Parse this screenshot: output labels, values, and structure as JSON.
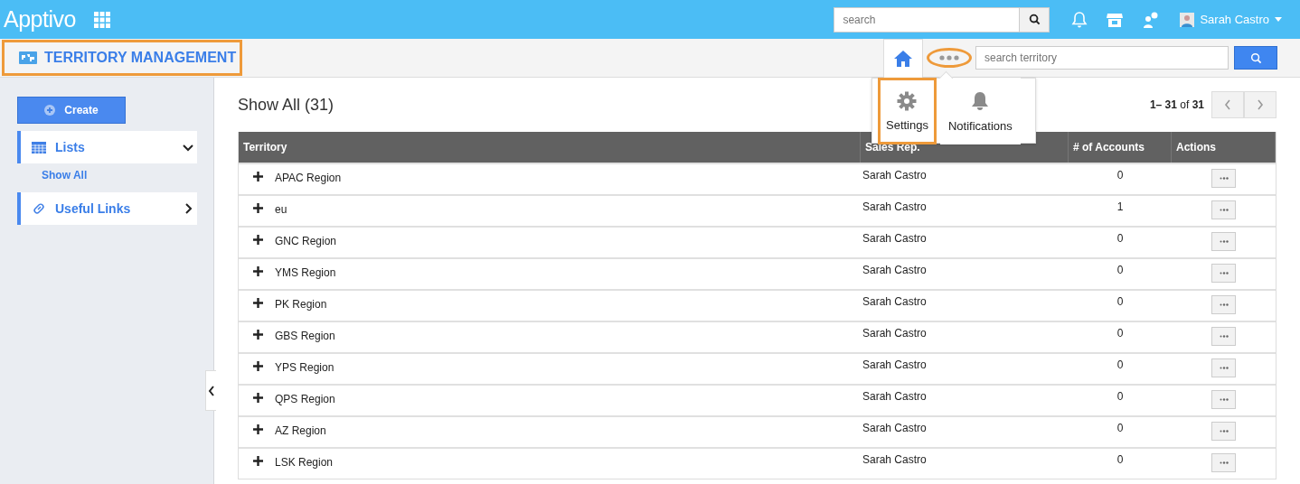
{
  "top_bar": {
    "logo": "Apptivo",
    "search": {
      "placeholder": "search"
    },
    "user": "Sarah Castro"
  },
  "app_bar": {
    "title": "TERRITORY MANAGEMENT",
    "title_highlighted": true,
    "more_highlighted": true,
    "search": {
      "placeholder": "search territory"
    }
  },
  "popup_menu": {
    "items": [
      {
        "label": "Settings",
        "kind": "settings",
        "highlighted": true
      },
      {
        "label": "Notifications",
        "kind": "notifications",
        "highlighted": false
      }
    ]
  },
  "sidebar": {
    "create": "Create",
    "sections": [
      {
        "label": "Lists",
        "kind": "lists",
        "expanded": true,
        "children": [
          {
            "label": "Show All",
            "selected": true
          }
        ]
      },
      {
        "label": "Useful Links",
        "kind": "links",
        "expanded": false
      }
    ]
  },
  "content": {
    "heading": "Show All (31)",
    "pagination": "**1– 31** of **31**"
  },
  "table": {
    "columns": [
      "Territory",
      "Sales Rep.",
      "# of Accounts",
      "Actions"
    ],
    "rows": [
      {
        "territory": "APAC Region",
        "sales_rep": "Sarah Castro",
        "accounts": "0"
      },
      {
        "territory": "eu",
        "sales_rep": "Sarah Castro",
        "accounts": "1"
      },
      {
        "territory": "GNC Region",
        "sales_rep": "Sarah Castro",
        "accounts": "0"
      },
      {
        "territory": "YMS Region",
        "sales_rep": "Sarah Castro",
        "accounts": "0"
      },
      {
        "territory": "PK Region",
        "sales_rep": "Sarah Castro",
        "accounts": "0"
      },
      {
        "territory": "GBS Region",
        "sales_rep": "Sarah Castro",
        "accounts": "0"
      },
      {
        "territory": "YPS Region",
        "sales_rep": "Sarah Castro",
        "accounts": "0"
      },
      {
        "territory": "QPS Region",
        "sales_rep": "Sarah Castro",
        "accounts": "0"
      },
      {
        "territory": "AZ Region",
        "sales_rep": "Sarah Castro",
        "accounts": "0"
      },
      {
        "territory": "LSK Region",
        "sales_rep": "Sarah Castro",
        "accounts": "0"
      }
    ]
  }
}
